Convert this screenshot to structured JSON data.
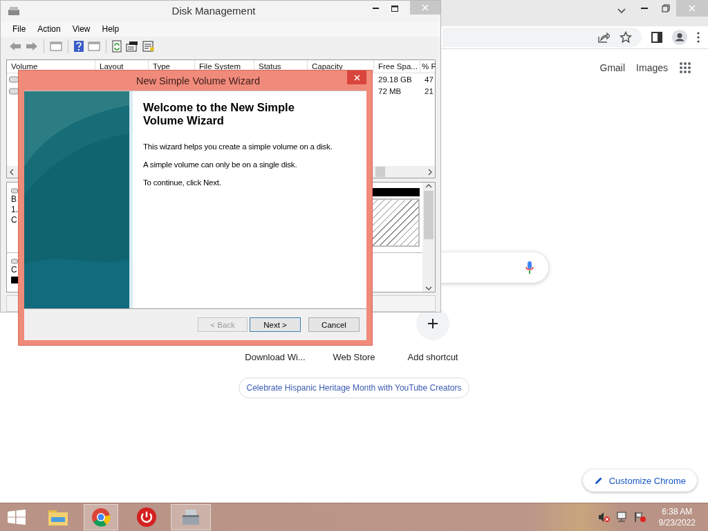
{
  "browser": {
    "header_links": [
      "Gmail",
      "Images"
    ],
    "shortcuts": [
      {
        "label": "Download Wi...",
        "kind": "site"
      },
      {
        "label": "Web Store",
        "kind": "site"
      },
      {
        "label": "Add shortcut",
        "kind": "add"
      }
    ],
    "promo": "Celebrate Hispanic Heritage Month with YouTube Creators",
    "customize_button": "Customize Chrome"
  },
  "disk_management": {
    "title": "Disk Management",
    "menu": [
      "File",
      "Action",
      "View",
      "Help"
    ],
    "columns": [
      "Volume",
      "Layout",
      "Type",
      "File System",
      "Status",
      "Capacity",
      "Free Spa...",
      "% F"
    ],
    "rows": [
      {
        "free_space": "29.18 GB",
        "percent_free": "47"
      },
      {
        "free_space": "72 MB",
        "percent_free": "21"
      }
    ],
    "disks": [
      {
        "fragments": [
          "B",
          "1.",
          "C"
        ]
      },
      {
        "fragments": [
          "C"
        ]
      }
    ]
  },
  "wizard": {
    "title": "New Simple Volume Wizard",
    "heading": "Welcome to the New Simple Volume Wizard",
    "paragraphs": [
      "This wizard helps you create a simple volume on a disk.",
      "A simple volume can only be on a single disk.",
      "To continue, click Next."
    ],
    "buttons": [
      {
        "label": "< Back",
        "disabled": true,
        "default": false
      },
      {
        "label": "Next >",
        "disabled": false,
        "default": true
      },
      {
        "label": "Cancel",
        "disabled": false,
        "default": false
      }
    ]
  },
  "taskbar": {
    "apps": [
      {
        "kind": "folder",
        "active": false
      },
      {
        "kind": "browser",
        "active": true
      },
      {
        "kind": "power",
        "active": false
      },
      {
        "kind": "disk",
        "active": true
      }
    ],
    "time": "6:38 AM",
    "date": "9/23/2022"
  }
}
